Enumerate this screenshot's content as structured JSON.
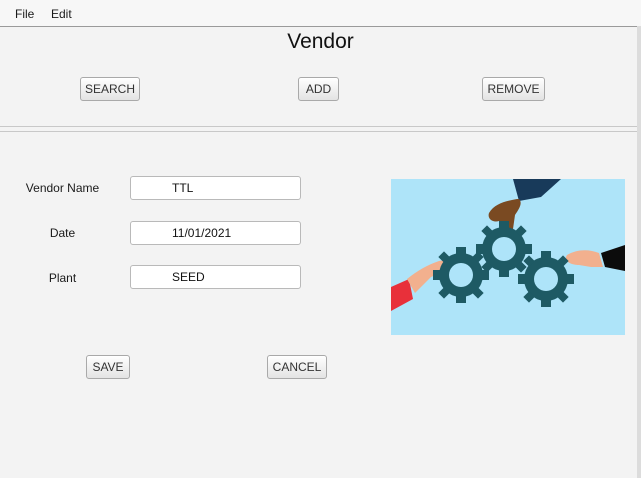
{
  "menu": {
    "file": "File",
    "edit": "Edit"
  },
  "header": {
    "title": "Vendor"
  },
  "toolbar": {
    "search": "SEARCH",
    "add": "ADD",
    "remove": "REMOVE"
  },
  "form": {
    "vendor_name": {
      "label": "Vendor Name",
      "value": "TTL"
    },
    "date": {
      "label": "Date",
      "value": "11/01/2021"
    },
    "plant": {
      "label": "Plant",
      "value": "SEED"
    }
  },
  "actions": {
    "save": "SAVE",
    "cancel": "CANCEL"
  },
  "image": {
    "subject": "hands-joining-gears",
    "background": "#aee4f9",
    "gear_color": "#1e5a64"
  }
}
